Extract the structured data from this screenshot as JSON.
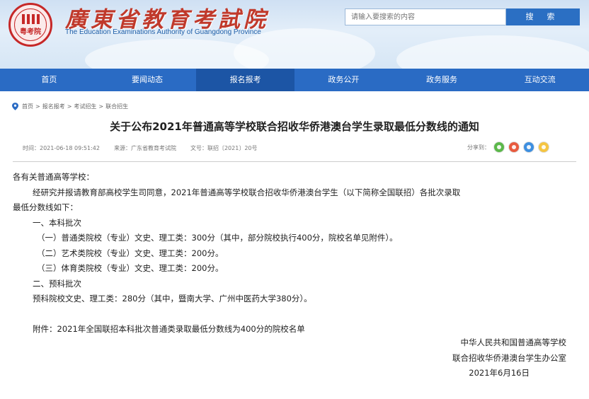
{
  "header": {
    "seal_text": "粤考院",
    "title": "廣東省教育考試院",
    "subtitle": "The Education Examinations Authority of Guangdong Province",
    "search_placeholder": "请输入要搜索的内容",
    "search_button": "搜 索"
  },
  "nav": {
    "items": [
      {
        "label": "首页"
      },
      {
        "label": "要闻动态"
      },
      {
        "label": "报名报考"
      },
      {
        "label": "政务公开"
      },
      {
        "label": "政务服务"
      },
      {
        "label": "互动交流"
      }
    ]
  },
  "breadcrumb": [
    "首页",
    "报名报考",
    "考试招生",
    "联合招生"
  ],
  "article": {
    "title": "关于公布2021年普通高等学校联合招收华侨港澳台学生录取最低分数线的通知",
    "meta_time": "时间：2021-06-18 09:51:42",
    "meta_source": "来源：广东省教育考试院",
    "meta_docno": "文号：联招〔2021〕20号",
    "share_label": "分享到：",
    "paragraphs": [
      "各有关普通高等学校：",
      "经研究并报请教育部高校学生司同意，2021年普通高等学校联合招收华侨港澳台学生（以下简称全国联招）各批次录取",
      "最低分数线如下：",
      "一、本科批次",
      "（一）普通类院校（专业）文史、理工类：300分（其中，部分院校执行400分，院校名单见附件）。",
      "（二）艺术类院校（专业）文史、理工类：200分。",
      "（三）体育类院校（专业）文史、理工类：200分。",
      "二、预科批次",
      "预科院校文史、理工类：280分（其中，暨南大学、广州中医药大学380分）。",
      "附件：2021年全国联招本科批次普通类录取最低分数线为400分的院校名单"
    ],
    "signature": [
      "中华人民共和国普通高等学校",
      "联合招收华侨港澳台学生办公室",
      "2021年6月16日"
    ]
  },
  "colors": {
    "nav_bg": "#2a6bc4",
    "title_red": "#c0392b",
    "search_button_bg": "#2b6fc3"
  }
}
